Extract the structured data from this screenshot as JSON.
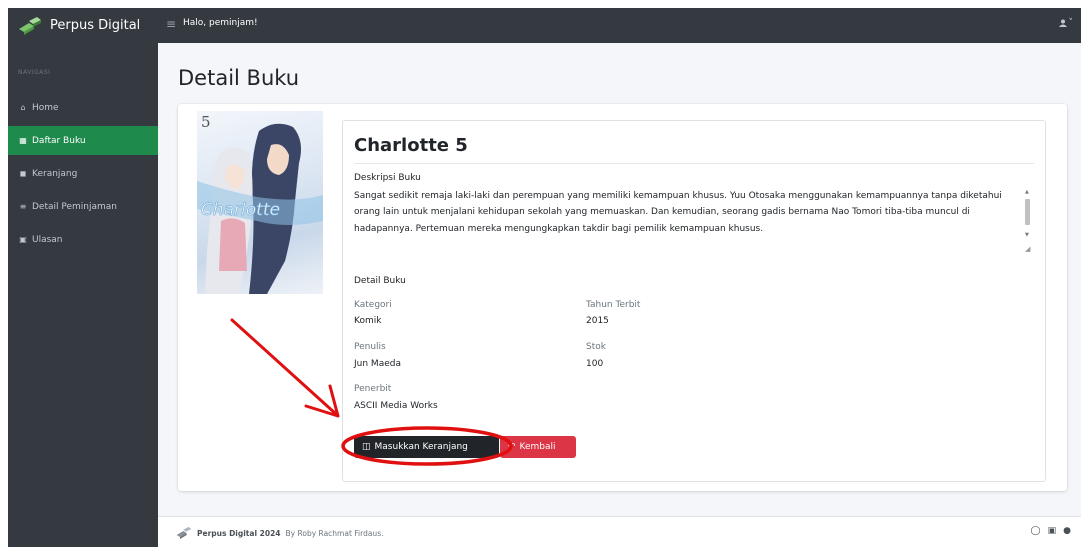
{
  "app": {
    "brand": "Perpus Digital",
    "greeting": "Halo, peminjam!"
  },
  "sidebar": {
    "header": "NAVIGASI",
    "items": [
      {
        "label": "Home",
        "icon": "home-icon",
        "active": false
      },
      {
        "label": "Daftar Buku",
        "icon": "book-icon",
        "active": true
      },
      {
        "label": "Keranjang",
        "icon": "basket-icon",
        "active": false
      },
      {
        "label": "Detail Peminjaman",
        "icon": "list-icon",
        "active": false
      },
      {
        "label": "Ulasan",
        "icon": "comment-icon",
        "active": false
      }
    ]
  },
  "page": {
    "title": "Detail Buku"
  },
  "book": {
    "title": "Charlotte 5",
    "description_heading": "Deskripsi Buku",
    "description": "Sangat sedikit remaja laki-laki dan perempuan yang memiliki kemampuan khusus. Yuu Otosaka menggunakan kemampuannya tanpa diketahui orang lain untuk menjalani kehidupan sekolah yang memuaskan. Dan kemudian, seorang gadis bernama Nao Tomori tiba-tiba muncul di hadapannya. Pertemuan mereka mengungkapkan takdir bagi pemilik kemampuan khusus.",
    "details_heading": "Detail Buku",
    "fields": {
      "kategori": {
        "label": "Kategori",
        "value": "Komik"
      },
      "tahun": {
        "label": "Tahun Terbit",
        "value": "2015"
      },
      "penulis": {
        "label": "Penulis",
        "value": "Jun Maeda"
      },
      "stok": {
        "label": "Stok",
        "value": "100"
      },
      "penerbit": {
        "label": "Penerbit",
        "value": "ASCII Media Works"
      }
    },
    "cover": {
      "volume": "5",
      "logo_text": "Charlotte"
    }
  },
  "buttons": {
    "cart": "Masukkan Keranjang",
    "back": "Kembali"
  },
  "footer": {
    "brand": "Perpus Digital 2024",
    "credit": "By Roby Rachmat Firdaus."
  },
  "colors": {
    "sidebar": "#343a40",
    "active": "#1e8a4c",
    "cart_button": "#212529",
    "back_button": "#dc3545",
    "annotation": "#e01010"
  }
}
